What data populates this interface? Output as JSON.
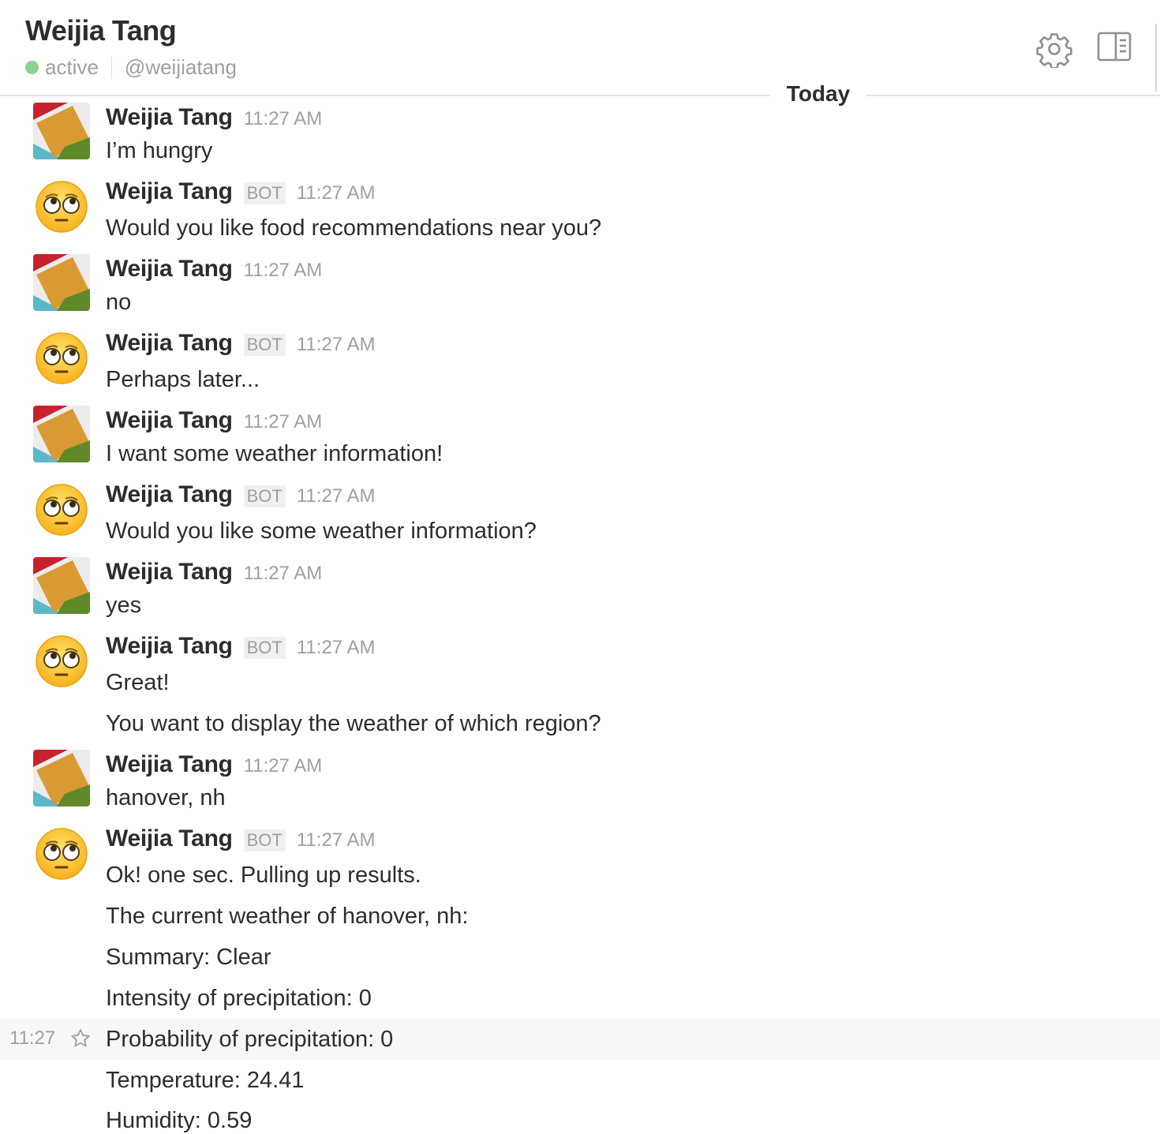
{
  "header": {
    "title": "Weijia Tang",
    "status": "active",
    "handle": "@weijiatang",
    "status_color": "#8ecf8e"
  },
  "divider": {
    "label": "Today"
  },
  "icons": {
    "settings": "gear-icon",
    "details": "panel-icon",
    "star": "star-icon"
  },
  "messages": [
    {
      "name": "Weijia Tang",
      "time": "11:27 AM",
      "lines": [
        "I’m hungry"
      ]
    },
    {
      "name": "Weijia Tang",
      "bot": "BOT",
      "time": "11:27 AM",
      "lines": [
        "Would you like food recommendations near you?"
      ]
    },
    {
      "name": "Weijia Tang",
      "time": "11:27 AM",
      "lines": [
        "no"
      ]
    },
    {
      "name": "Weijia Tang",
      "bot": "BOT",
      "time": "11:27 AM",
      "lines": [
        "Perhaps later..."
      ]
    },
    {
      "name": "Weijia Tang",
      "time": "11:27 AM",
      "lines": [
        "I want some weather information!"
      ]
    },
    {
      "name": "Weijia Tang",
      "bot": "BOT",
      "time": "11:27 AM",
      "lines": [
        "Would you like some weather information?"
      ]
    },
    {
      "name": "Weijia Tang",
      "time": "11:27 AM",
      "lines": [
        "yes"
      ]
    },
    {
      "name": "Weijia Tang",
      "bot": "BOT",
      "time": "11:27 AM",
      "lines": [
        "Great!",
        "You want to display the weather of which region?"
      ]
    },
    {
      "name": "Weijia Tang",
      "time": "11:27 AM",
      "lines": [
        "hanover, nh"
      ]
    },
    {
      "name": "Weijia Tang",
      "bot": "BOT",
      "time": "11:27 AM",
      "lines": [
        "Ok! one sec. Pulling up results.",
        "The current weather of hanover, nh:",
        "Summary: Clear",
        "Intensity of precipitation: 0",
        "Probability of precipitation: 0",
        "Temperature: 24.41",
        "Humidity: 0.59"
      ]
    }
  ],
  "hover": {
    "time": "11:27"
  }
}
